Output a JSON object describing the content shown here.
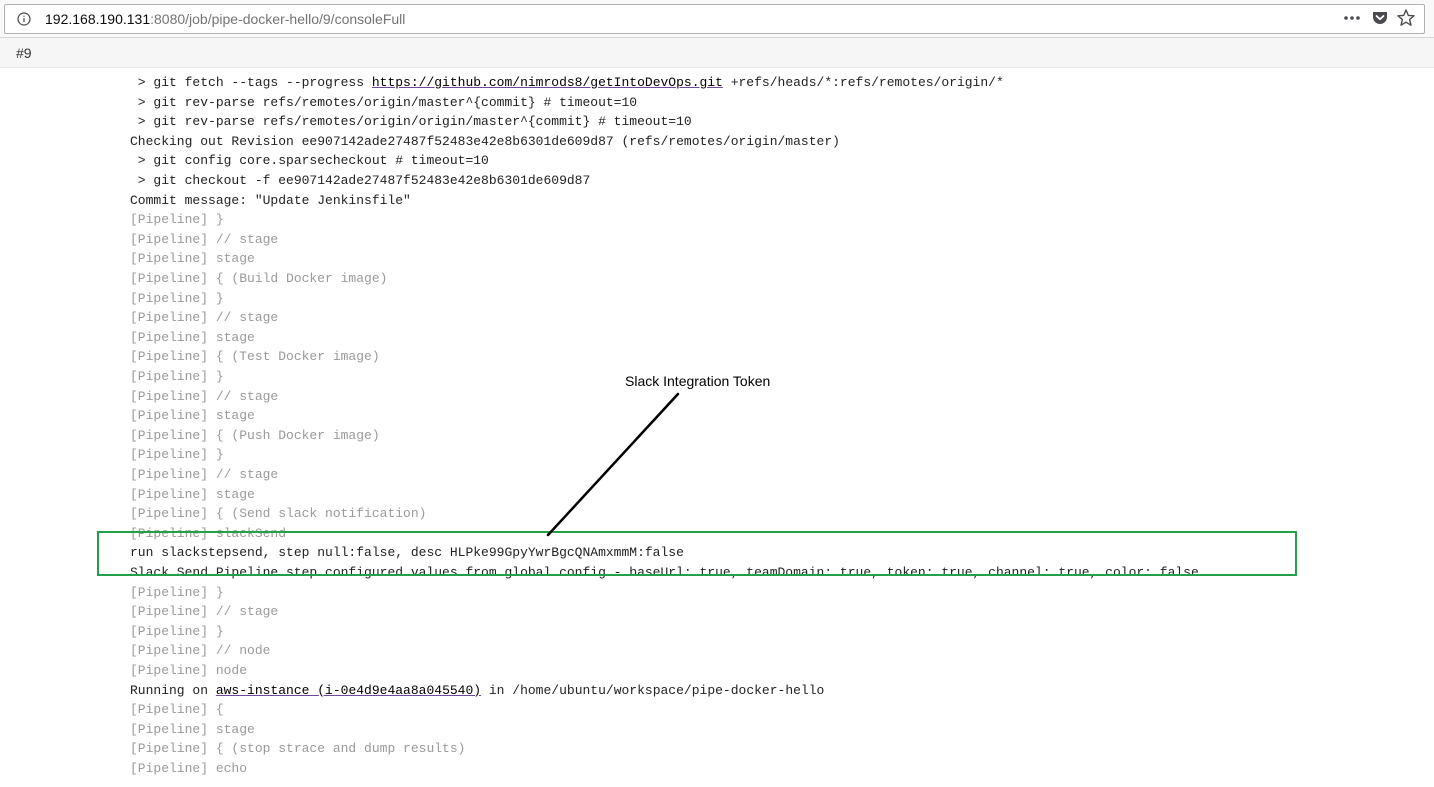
{
  "browser": {
    "url_host": "192.168.190.131",
    "url_rest": ":8080/job/pipe-docker-hello/9/consoleFull",
    "icons": [
      "info-icon",
      "more-icon",
      "pocket-icon",
      "bookmark-star-icon"
    ]
  },
  "build": {
    "number": "#9"
  },
  "console": {
    "lines": [
      {
        "kind": "git",
        "parts": [
          " > git fetch --tags --progress ",
          {
            "link": "https://github.com/nimrods8/getIntoDevOps.git"
          },
          " +refs/heads/*:refs/remotes/origin/*"
        ]
      },
      {
        "kind": "git",
        "parts": [
          " > git rev-parse refs/remotes/origin/master^{commit} # timeout=10"
        ]
      },
      {
        "kind": "git",
        "parts": [
          " > git rev-parse refs/remotes/origin/origin/master^{commit} # timeout=10"
        ]
      },
      {
        "kind": "normal",
        "parts": [
          "Checking out Revision ee907142ade27487f52483e42e8b6301de609d87 (refs/remotes/origin/master)"
        ]
      },
      {
        "kind": "git",
        "parts": [
          " > git config core.sparsecheckout # timeout=10"
        ]
      },
      {
        "kind": "git",
        "parts": [
          " > git checkout -f ee907142ade27487f52483e42e8b6301de609d87"
        ]
      },
      {
        "kind": "normal",
        "parts": [
          "Commit message: \"Update Jenkinsfile\""
        ]
      },
      {
        "kind": "pipeline",
        "parts": [
          "[Pipeline] }"
        ]
      },
      {
        "kind": "pipeline",
        "parts": [
          "[Pipeline] // stage"
        ]
      },
      {
        "kind": "pipeline",
        "parts": [
          "[Pipeline] stage"
        ]
      },
      {
        "kind": "pipeline",
        "parts": [
          "[Pipeline] { (Build Docker image)"
        ]
      },
      {
        "kind": "pipeline",
        "parts": [
          "[Pipeline] }"
        ]
      },
      {
        "kind": "pipeline",
        "parts": [
          "[Pipeline] // stage"
        ]
      },
      {
        "kind": "pipeline",
        "parts": [
          "[Pipeline] stage"
        ]
      },
      {
        "kind": "pipeline",
        "parts": [
          "[Pipeline] { (Test Docker image)"
        ]
      },
      {
        "kind": "pipeline",
        "parts": [
          "[Pipeline] }"
        ]
      },
      {
        "kind": "pipeline",
        "parts": [
          "[Pipeline] // stage"
        ]
      },
      {
        "kind": "pipeline",
        "parts": [
          "[Pipeline] stage"
        ]
      },
      {
        "kind": "pipeline",
        "parts": [
          "[Pipeline] { (Push Docker image)"
        ]
      },
      {
        "kind": "pipeline",
        "parts": [
          "[Pipeline] }"
        ]
      },
      {
        "kind": "pipeline",
        "parts": [
          "[Pipeline] // stage"
        ]
      },
      {
        "kind": "pipeline",
        "parts": [
          "[Pipeline] stage"
        ]
      },
      {
        "kind": "pipeline",
        "parts": [
          "[Pipeline] { (Send slack notification)"
        ]
      },
      {
        "kind": "pipeline",
        "parts": [
          "[Pipeline] slackSend"
        ]
      },
      {
        "kind": "normal",
        "parts": [
          "run slackstepsend, step null:false, desc HLPke99GpyYwrBgcQNAmxmmM:false"
        ]
      },
      {
        "kind": "normal",
        "parts": [
          "Slack Send Pipeline step configured values from global config - baseUrl: true, teamDomain: true, token: true, channel: true, color: false"
        ]
      },
      {
        "kind": "pipeline",
        "parts": [
          "[Pipeline] }"
        ]
      },
      {
        "kind": "pipeline",
        "parts": [
          "[Pipeline] // stage"
        ]
      },
      {
        "kind": "pipeline",
        "parts": [
          "[Pipeline] }"
        ]
      },
      {
        "kind": "pipeline",
        "parts": [
          "[Pipeline] // node"
        ]
      },
      {
        "kind": "pipeline",
        "parts": [
          "[Pipeline] node"
        ]
      },
      {
        "kind": "normal",
        "parts": [
          "Running on ",
          {
            "link": "aws-instance (i-0e4d9e4aa8a045540)"
          },
          " in /home/ubuntu/workspace/pipe-docker-hello"
        ]
      },
      {
        "kind": "pipeline",
        "parts": [
          "[Pipeline] {"
        ]
      },
      {
        "kind": "pipeline",
        "parts": [
          "[Pipeline] stage"
        ]
      },
      {
        "kind": "pipeline",
        "parts": [
          "[Pipeline] { (stop strace and dump results)"
        ]
      },
      {
        "kind": "pipeline",
        "parts": [
          "[Pipeline] echo"
        ]
      }
    ]
  },
  "annotation": {
    "label": "Slack Integration Token",
    "highlight_color": "#23a14a"
  }
}
